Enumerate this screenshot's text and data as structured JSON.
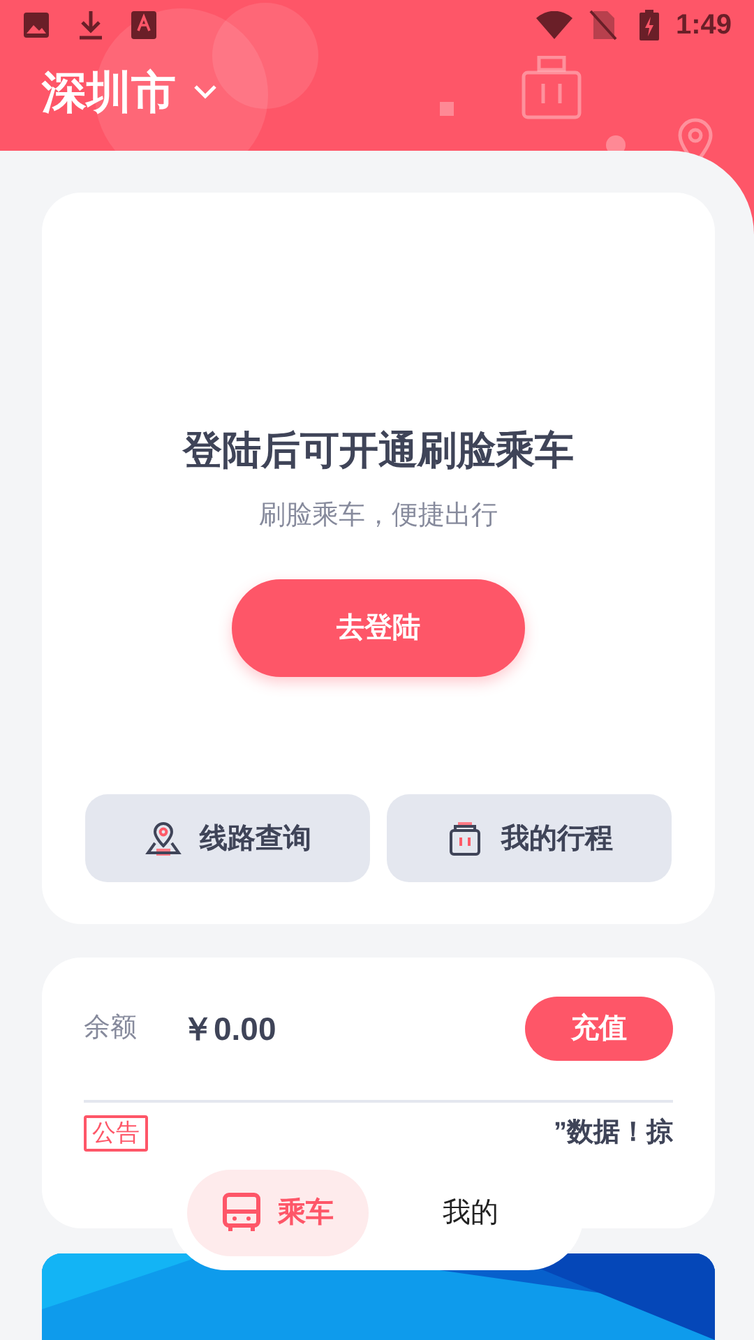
{
  "status_bar": {
    "time": "1:49"
  },
  "header": {
    "city": "深圳市"
  },
  "login_card": {
    "title": "登陆后可开通刷脸乘车",
    "subtitle": "刷脸乘车，便捷出行",
    "button": "去登陆",
    "actions": [
      {
        "label": "线路查询",
        "kind": "route"
      },
      {
        "label": "我的行程",
        "kind": "trips"
      }
    ]
  },
  "balance_card": {
    "label": "余额",
    "amount": "￥0.00",
    "button": "充值",
    "notice_tag": "公告",
    "notice_text": "”数据！掠"
  },
  "bottom_nav": [
    {
      "label": "乘车",
      "selected": true
    },
    {
      "label": "我的",
      "selected": false
    }
  ]
}
